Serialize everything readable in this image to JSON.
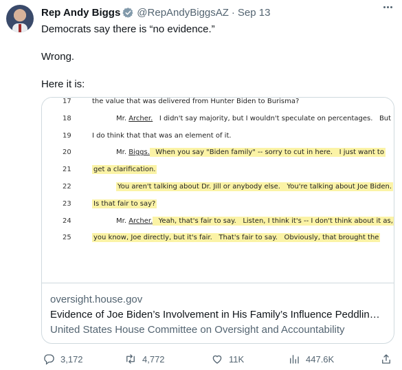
{
  "tweet": {
    "name": "Rep Andy Biggs",
    "handle": "@RepAndyBiggsAZ",
    "separator": "·",
    "date": "Sep 13",
    "lines": [
      "Democrats say there is “no evidence.”",
      "Wrong.",
      "Here it is:"
    ]
  },
  "document": {
    "lines": [
      {
        "num": "17",
        "segments": [
          {
            "text": "the value that was delivered from Hunter Biden to Burisma?",
            "hl": false
          }
        ]
      },
      {
        "num": "18",
        "segments": [
          {
            "text": "Mr. ",
            "hl": false
          },
          {
            "text": "Archer.",
            "hl": false,
            "u": true
          },
          {
            "text": "   I didn't say majority, but I wouldn't speculate on percentages.   But",
            "hl": false
          }
        ]
      },
      {
        "num": "19",
        "segments": [
          {
            "text": "I do think that that was an element of it.",
            "hl": false
          }
        ]
      },
      {
        "num": "20",
        "segments": [
          {
            "text": "Mr. ",
            "hl": false
          },
          {
            "text": "Biggs.",
            "hl": false,
            "u": true
          },
          {
            "text": "  When you say \"Biden family\" -- sorry to cut in here.   I just want to",
            "hl": true
          }
        ]
      },
      {
        "num": "21",
        "segments": [
          {
            "text": "get a clarification.",
            "hl": true
          }
        ]
      },
      {
        "num": "22",
        "segments": [
          {
            "text": "You aren't talking about Dr. Jill or anybody else.   You're talking about Joe Biden.",
            "hl": true
          }
        ]
      },
      {
        "num": "23",
        "segments": [
          {
            "text": "Is that fair to say?",
            "hl": true
          }
        ]
      },
      {
        "num": "24",
        "segments": [
          {
            "text": "Mr. ",
            "hl": false
          },
          {
            "text": "Archer.",
            "hl": false,
            "u": true
          },
          {
            "text": "  Yeah, that's fair to say.   Listen, I think it's -- I don't think about it as,",
            "hl": true
          }
        ]
      },
      {
        "num": "25",
        "segments": [
          {
            "text": "you know, Joe directly, but it's fair.   That's fair to say.   Obviously, that brought the",
            "hl": true
          }
        ]
      }
    ]
  },
  "card": {
    "domain": "oversight.house.gov",
    "title": "Evidence of Joe Biden’s Involvement in His Family’s Influence Peddlin…",
    "description": "United States House Committee on Oversight and Accountability"
  },
  "actions": {
    "replies": "3,172",
    "retweets": "4,772",
    "likes": "11K",
    "views": "447.6K"
  },
  "icons": [
    "verified-badge-icon",
    "more-icon",
    "reply-icon",
    "retweet-icon",
    "like-icon",
    "views-icon",
    "share-icon"
  ],
  "colors": {
    "verified": "#829aab",
    "highlight": "#fbf3a6",
    "muted": "#536471"
  }
}
